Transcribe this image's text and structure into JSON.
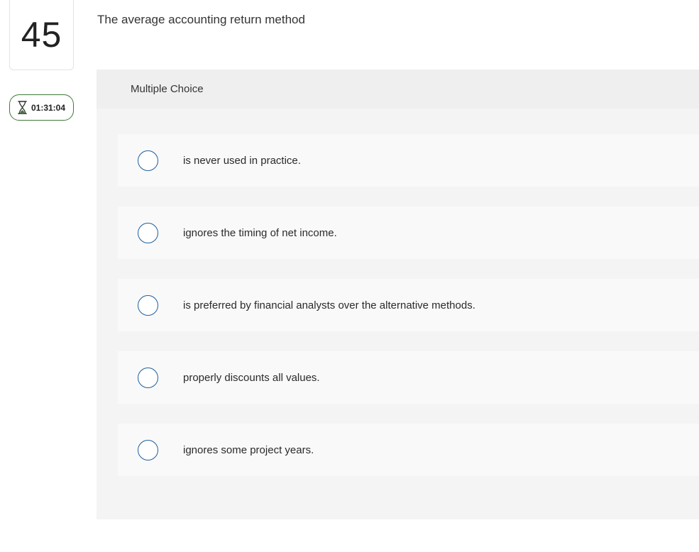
{
  "question": {
    "number": "45",
    "prompt": "The average accounting return method"
  },
  "timer": {
    "icon": "hourglass-icon",
    "value": "01:31:04",
    "accent_color": "#3f7a3a"
  },
  "panel": {
    "type_label": "Multiple Choice",
    "options": [
      {
        "text": "is never used in practice."
      },
      {
        "text": "ignores the timing of net income."
      },
      {
        "text": "is preferred by financial analysts over the alternative methods."
      },
      {
        "text": "properly discounts all values."
      },
      {
        "text": "ignores some project years."
      }
    ]
  },
  "colors": {
    "radio_border": "#1f5f9e",
    "panel_bg": "#f4f4f4",
    "option_bg": "#f9f9f9"
  }
}
